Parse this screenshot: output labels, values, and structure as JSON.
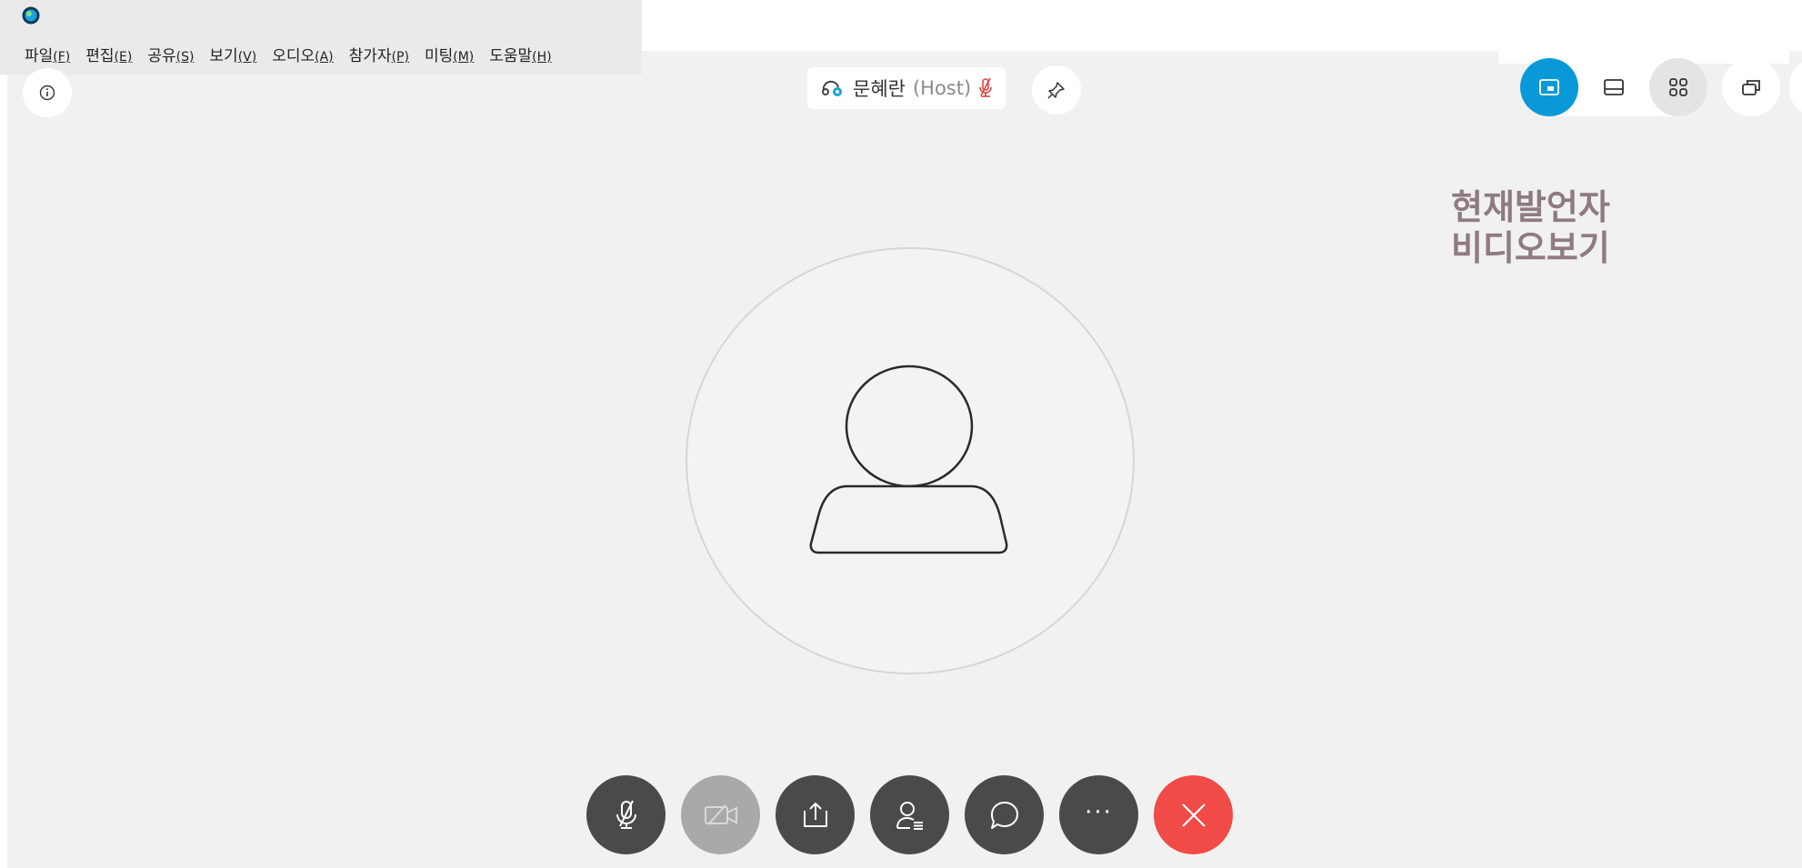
{
  "menu": {
    "items": [
      {
        "label": "파일",
        "accel": "(F)"
      },
      {
        "label": "편집",
        "accel": "(E)"
      },
      {
        "label": "공유",
        "accel": "(S)"
      },
      {
        "label": "보기",
        "accel": "(V)"
      },
      {
        "label": "오디오",
        "accel": "(A)"
      },
      {
        "label": "참가자",
        "accel": "(P)"
      },
      {
        "label": "미팅",
        "accel": "(M)"
      },
      {
        "label": "도움말",
        "accel": "(H)"
      }
    ]
  },
  "speaker": {
    "name": "문혜란",
    "role": "(Host)",
    "mic_state": "muted"
  },
  "annotation": {
    "line1": "현재발언자",
    "line2": "비디오보기"
  },
  "colors": {
    "accent": "#0a99d8",
    "end_call": "#f04b47",
    "muted_mic": "#e0443f",
    "annotation": "#8f7b7f"
  },
  "icons": {
    "info": "info-icon",
    "pin": "pin-icon",
    "layout_active": "stage-view-icon",
    "layout_filmstrip": "filmstrip-icon",
    "layout_grid": "grid-icon",
    "window": "popout-icon",
    "avatar": "person-placeholder-icon",
    "controls": [
      "mic-muted-icon",
      "video-off-icon",
      "share-icon",
      "participants-icon",
      "chat-icon",
      "more-icon",
      "close-icon"
    ]
  }
}
